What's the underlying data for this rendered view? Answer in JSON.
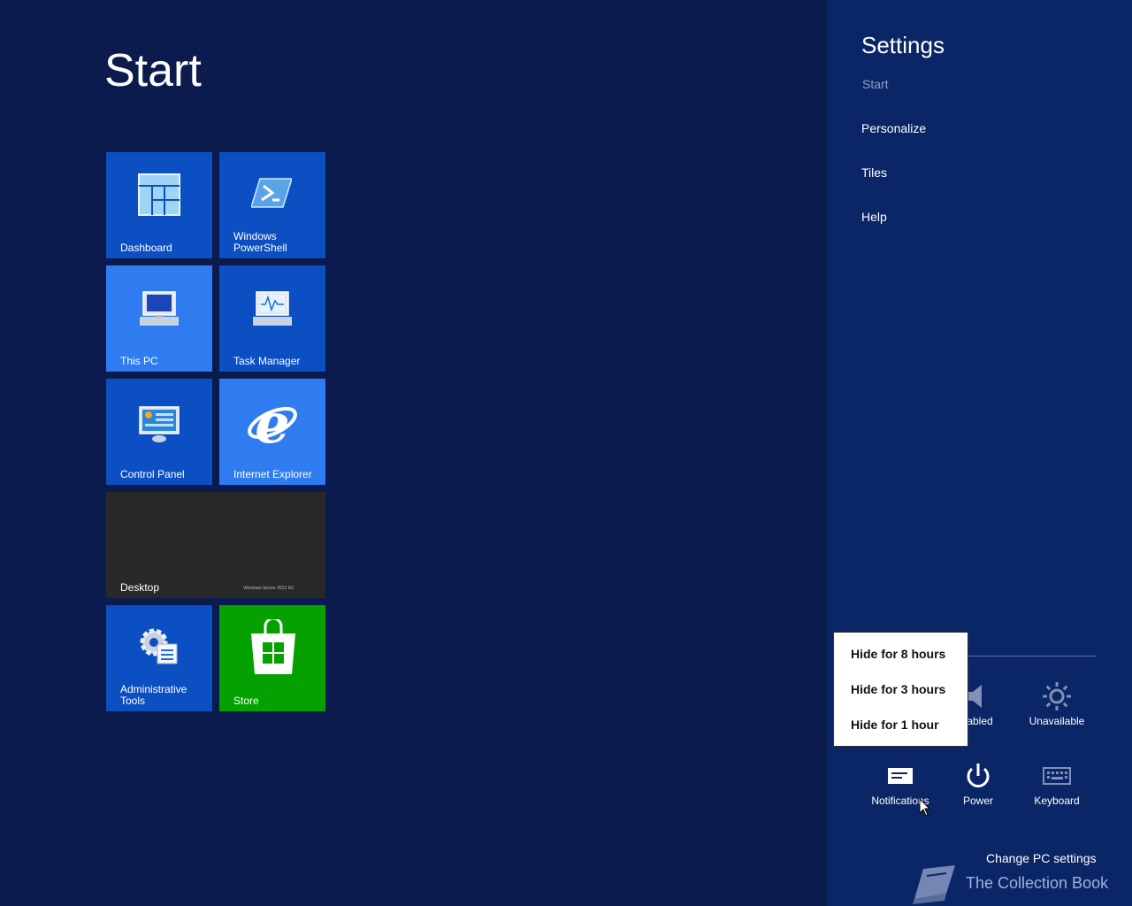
{
  "start": {
    "title": "Start"
  },
  "tiles": [
    {
      "label": "Dashboard",
      "icon": "dashboard-icon"
    },
    {
      "label": "Windows PowerShell",
      "icon": "powershell-icon"
    },
    {
      "label": "This PC",
      "icon": "computer-icon"
    },
    {
      "label": "Task Manager",
      "icon": "task-manager-icon"
    },
    {
      "label": "Control Panel",
      "icon": "control-panel-icon"
    },
    {
      "label": "Internet Explorer",
      "icon": "internet-explorer-icon"
    },
    {
      "label": "Desktop",
      "watermark": "Windows Server 2012 R2"
    },
    {
      "label": "Administrative Tools",
      "icon": "admin-tools-icon"
    },
    {
      "label": "Store",
      "icon": "store-icon"
    }
  ],
  "charm": {
    "title": "Settings",
    "subtitle": "Start",
    "items": [
      "Personalize",
      "Tiles",
      "Help"
    ],
    "quick": {
      "volume": "sabled",
      "brightness": "Unavailable",
      "notifications": "Notifications",
      "power": "Power",
      "keyboard": "Keyboard"
    },
    "change_settings": "Change PC settings"
  },
  "popup": {
    "items": [
      "Hide for 8 hours",
      "Hide for 3 hours",
      "Hide for 1 hour"
    ]
  },
  "watermark_brand": "The Collection Book",
  "colors": {
    "background": "#0b1b4d",
    "charm": "#0b2666",
    "tile_blue": "#0b4fc2",
    "tile_light": "#2f7cf0",
    "tile_green": "#04a100"
  }
}
